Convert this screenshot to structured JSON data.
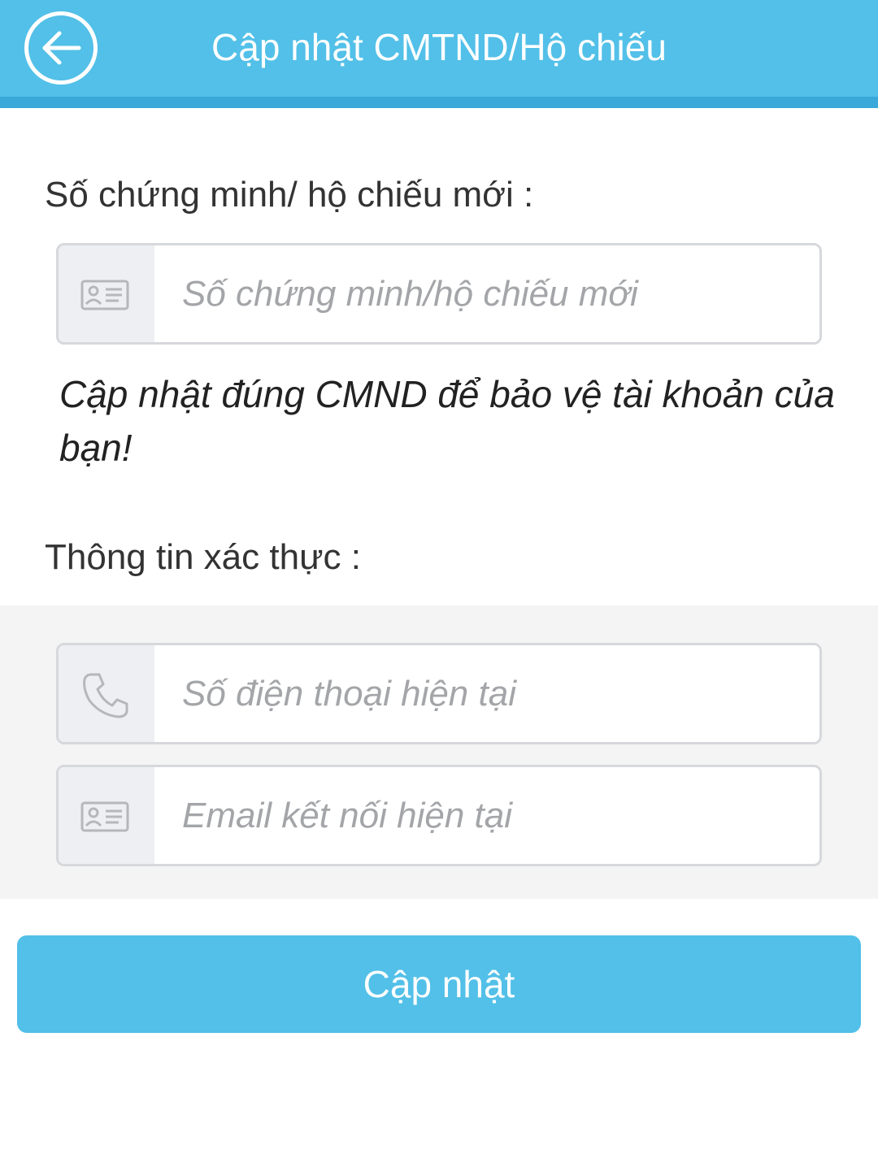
{
  "header": {
    "title": "Cập nhật CMTND/Hộ chiếu",
    "back_icon": "arrow-left-circle-icon",
    "background": "#52c0e8"
  },
  "new_id_section": {
    "label": "Số chứng minh/ hộ chiếu mới :",
    "field": {
      "icon": "id-card-icon",
      "placeholder": "Số chứng minh/hộ chiếu mới",
      "value": ""
    },
    "hint": "Cập nhật đúng CMND để bảo vệ tài khoản của bạn!"
  },
  "verification_section": {
    "label": "Thông tin xác thực :",
    "phone_field": {
      "icon": "phone-icon",
      "placeholder": "Số điện thoại hiện tại",
      "value": ""
    },
    "email_field": {
      "icon": "id-card-icon",
      "placeholder": "Email kết nối hiện tại",
      "value": ""
    }
  },
  "submit": {
    "label": "Cập nhật",
    "color": "#52c0e8"
  }
}
